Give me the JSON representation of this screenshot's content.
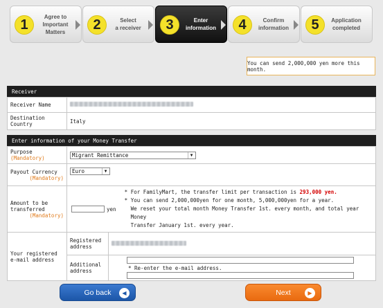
{
  "steps": [
    {
      "num": "1",
      "label": "Agree to\nImportant\nMatters",
      "active": false
    },
    {
      "num": "2",
      "label": "Select\na receiver",
      "active": false
    },
    {
      "num": "3",
      "label": "Enter\ninformation",
      "active": true
    },
    {
      "num": "4",
      "label": "Confirm\ninformation",
      "active": false
    },
    {
      "num": "5",
      "label": "Application\ncompleted",
      "active": false
    }
  ],
  "limit_notice": "You can send 2,000,000 yen more this month.",
  "receiver": {
    "header": "Receiver",
    "name_label": "Receiver Name",
    "country_label": "Destination Country",
    "country_value": "Italy"
  },
  "transfer": {
    "header": "Enter information of your Money Transfer",
    "purpose_label": "Purpose",
    "mandatory": "(Mandatory)",
    "purpose_value": "Migrant Remittance",
    "currency_label": "Payout Currency",
    "currency_value": "Euro",
    "amount_label": "Amount to be\ntransferred",
    "amount_value": "",
    "amount_unit": "yen",
    "note1_prefix": "* For FamilyMart, the transfer limit per transaction is ",
    "note1_limit": "293,000 yen.",
    "note2_line1": "* You can send 2,000,000yen for one month, 5,000,000yen for a year.",
    "note2_line2": "We reset your total month Money Transfer 1st. every month, and total year Money",
    "note2_line3": "Transfer January 1st. every year.",
    "email_label": "Your registered\ne-mail address",
    "registered_label": "Registered\naddress",
    "additional_label": "Additional\naddress",
    "additional_value": "",
    "reenter_note": "* Re-enter the e-mail address.",
    "reenter_value": ""
  },
  "buttons": {
    "back": "Go back",
    "next": "Next"
  },
  "colors": {
    "accent_orange": "#e96a10",
    "accent_blue": "#1c56a8",
    "step_number": "#f4e12a",
    "mandatory": "#e07b1b"
  }
}
